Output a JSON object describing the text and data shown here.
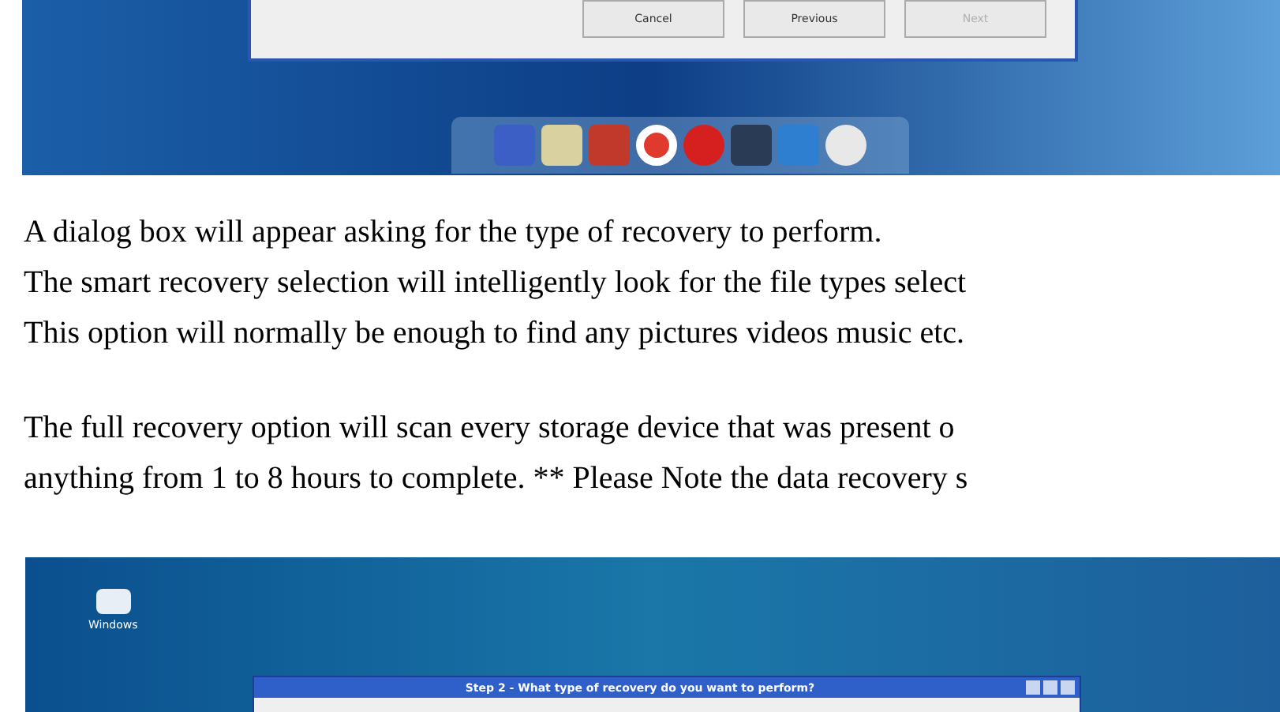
{
  "top_screenshot": {
    "buttons": [
      {
        "label": "Cancel",
        "disabled": false
      },
      {
        "label": "Previous",
        "disabled": false
      },
      {
        "label": "Next",
        "disabled": true
      }
    ]
  },
  "paragraphs": [
    {
      "lines": [
        "A dialog box will appear asking for the type of recovery to perform.",
        "The smart recovery selection will intelligently look for the file types select",
        "This option will normally be enough to find any pictures videos music etc."
      ]
    },
    {
      "lines": [
        "The full recovery option will scan every storage device that was present o",
        "anything from 1 to 8 hours to complete. ** Please Note the data recovery s"
      ]
    }
  ],
  "bottom_screenshot": {
    "desktop_icon": {
      "label": "Windows"
    },
    "dialog": {
      "title": "Step 2 - What type of recovery do you want to perform?"
    }
  }
}
